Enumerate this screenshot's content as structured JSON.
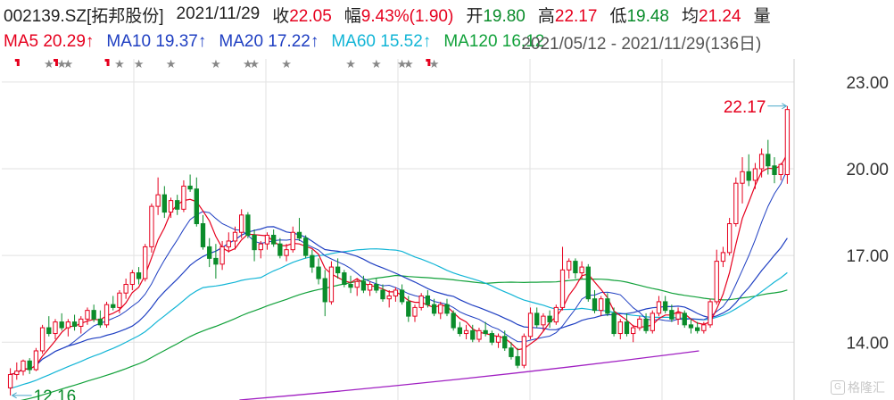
{
  "header": {
    "stock": "002139.SZ[拓邦股份]",
    "date": "2021/11/29",
    "close_label": "收",
    "close": "22.05",
    "change_label": "幅",
    "change": "9.43%(1.90)",
    "open_label": "开",
    "open": "19.80",
    "high_label": "高",
    "high": "22.17",
    "low_label": "低",
    "low": "19.48",
    "avg_label": "均",
    "avg": "21.24",
    "volume_label": "量"
  },
  "ma_legend": {
    "ma5": "MA5 20.29↑",
    "ma10": "MA10 19.37↑",
    "ma20": "MA20 17.22↑",
    "ma60": "MA60 15.52↑",
    "ma120": "MA120 16.12",
    "overlap_range": "2021/05/12 - 2021/11/29(136日)"
  },
  "colors": {
    "up": "#e6001e",
    "down": "#0a8c2b",
    "ma5": "#e6001e",
    "ma10": "#1f3fc2",
    "ma20": "#1f3fc2",
    "ma60": "#12b5d6",
    "ma120": "#11a13a",
    "ma250": "#a01fc2",
    "grid": "#e2e2e2"
  },
  "watermark": "格隆汇",
  "chart_data": {
    "type": "candlestick",
    "ylim": [
      12.0,
      23.8
    ],
    "yticks": [
      14.0,
      17.0,
      20.0,
      23.0
    ],
    "ytick_labels": [
      "14.00",
      "17.00",
      "20.00",
      "23.00"
    ],
    "annotations": {
      "max_label": "22.17",
      "min_label": "12.16"
    },
    "ohlc": [
      [
        12.42,
        13.1,
        12.16,
        12.88
      ],
      [
        12.88,
        13.3,
        12.7,
        13.0
      ],
      [
        13.0,
        13.4,
        12.85,
        13.35
      ],
      [
        13.35,
        13.45,
        12.9,
        13.05
      ],
      [
        13.05,
        13.8,
        13.0,
        13.7
      ],
      [
        13.7,
        14.6,
        13.6,
        14.5
      ],
      [
        14.5,
        14.9,
        14.2,
        14.3
      ],
      [
        14.3,
        14.8,
        14.1,
        14.7
      ],
      [
        14.7,
        15.0,
        14.4,
        14.5
      ],
      [
        14.5,
        14.8,
        14.2,
        14.7
      ],
      [
        14.7,
        14.95,
        14.4,
        14.55
      ],
      [
        14.55,
        14.9,
        14.3,
        14.8
      ],
      [
        14.8,
        15.2,
        14.6,
        15.1
      ],
      [
        15.1,
        15.3,
        14.7,
        14.8
      ],
      [
        14.8,
        15.1,
        14.5,
        14.6
      ],
      [
        14.6,
        15.4,
        14.5,
        15.3
      ],
      [
        15.3,
        15.6,
        15.1,
        15.2
      ],
      [
        15.2,
        15.8,
        15.0,
        15.7
      ],
      [
        15.7,
        16.2,
        15.5,
        16.0
      ],
      [
        16.0,
        16.5,
        15.8,
        16.4
      ],
      [
        16.4,
        16.6,
        16.0,
        16.2
      ],
      [
        16.2,
        17.4,
        16.1,
        17.3
      ],
      [
        17.3,
        18.8,
        17.1,
        18.7
      ],
      [
        18.7,
        19.7,
        18.4,
        19.1
      ],
      [
        19.1,
        19.4,
        18.3,
        18.5
      ],
      [
        18.5,
        19.0,
        18.3,
        18.9
      ],
      [
        18.9,
        19.1,
        18.4,
        18.6
      ],
      [
        18.6,
        19.6,
        18.5,
        19.4
      ],
      [
        19.4,
        19.8,
        19.2,
        19.3
      ],
      [
        19.3,
        19.7,
        18.0,
        18.1
      ],
      [
        18.1,
        18.4,
        17.2,
        17.3
      ],
      [
        17.3,
        17.6,
        16.6,
        16.9
      ],
      [
        16.9,
        17.4,
        16.2,
        16.7
      ],
      [
        16.7,
        17.5,
        16.5,
        17.3
      ],
      [
        17.3,
        17.8,
        17.1,
        17.5
      ],
      [
        17.5,
        18.0,
        17.2,
        17.8
      ],
      [
        17.8,
        18.6,
        17.6,
        18.4
      ],
      [
        18.4,
        18.5,
        17.6,
        17.7
      ],
      [
        17.7,
        17.9,
        16.8,
        17.2
      ],
      [
        17.2,
        17.5,
        16.9,
        17.4
      ],
      [
        17.4,
        17.8,
        17.2,
        17.7
      ],
      [
        17.7,
        17.9,
        17.3,
        17.4
      ],
      [
        17.4,
        17.6,
        16.9,
        17.0
      ],
      [
        17.0,
        17.4,
        16.8,
        17.2
      ],
      [
        17.2,
        18.0,
        17.1,
        17.8
      ],
      [
        17.8,
        18.3,
        17.5,
        17.6
      ],
      [
        17.6,
        17.7,
        16.9,
        17.0
      ],
      [
        17.0,
        17.2,
        16.4,
        16.6
      ],
      [
        16.6,
        16.9,
        16.0,
        16.2
      ],
      [
        16.2,
        16.5,
        14.9,
        15.4
      ],
      [
        15.4,
        16.8,
        15.3,
        16.6
      ],
      [
        16.6,
        16.9,
        16.2,
        16.4
      ],
      [
        16.4,
        16.5,
        15.9,
        16.0
      ],
      [
        16.0,
        16.3,
        15.7,
        15.9
      ],
      [
        15.9,
        16.2,
        15.6,
        16.1
      ],
      [
        16.1,
        16.3,
        15.7,
        15.8
      ],
      [
        15.8,
        16.1,
        15.6,
        16.0
      ],
      [
        16.0,
        16.2,
        15.7,
        15.8
      ],
      [
        15.8,
        16.0,
        15.4,
        15.5
      ],
      [
        15.5,
        15.8,
        15.2,
        15.6
      ],
      [
        15.6,
        15.9,
        15.4,
        15.8
      ],
      [
        15.8,
        16.0,
        15.3,
        15.4
      ],
      [
        15.4,
        15.6,
        14.7,
        14.9
      ],
      [
        14.9,
        15.3,
        14.7,
        15.2
      ],
      [
        15.2,
        15.7,
        15.1,
        15.6
      ],
      [
        15.6,
        15.8,
        15.2,
        15.3
      ],
      [
        15.3,
        15.5,
        14.9,
        15.0
      ],
      [
        15.0,
        15.4,
        14.8,
        15.3
      ],
      [
        15.3,
        15.5,
        14.9,
        15.0
      ],
      [
        15.0,
        15.1,
        14.4,
        14.5
      ],
      [
        14.5,
        14.7,
        14.2,
        14.3
      ],
      [
        14.3,
        14.6,
        14.1,
        14.4
      ],
      [
        14.4,
        14.6,
        14.0,
        14.1
      ],
      [
        14.1,
        14.5,
        14.0,
        14.4
      ],
      [
        14.4,
        14.7,
        14.2,
        14.3
      ],
      [
        14.3,
        14.4,
        13.9,
        14.0
      ],
      [
        14.0,
        14.3,
        13.8,
        14.2
      ],
      [
        14.2,
        14.4,
        13.7,
        13.8
      ],
      [
        13.8,
        14.0,
        13.4,
        13.5
      ],
      [
        13.5,
        13.8,
        13.1,
        13.2
      ],
      [
        13.2,
        14.3,
        13.1,
        14.2
      ],
      [
        14.2,
        15.2,
        14.1,
        15.0
      ],
      [
        15.0,
        15.2,
        14.5,
        14.6
      ],
      [
        14.6,
        15.0,
        14.4,
        14.9
      ],
      [
        14.9,
        15.1,
        14.5,
        14.7
      ],
      [
        14.7,
        15.3,
        14.6,
        15.2
      ],
      [
        15.2,
        17.3,
        15.1,
        16.5
      ],
      [
        16.5,
        16.9,
        16.2,
        16.8
      ],
      [
        16.8,
        16.9,
        16.2,
        16.4
      ],
      [
        16.4,
        16.8,
        16.2,
        16.6
      ],
      [
        16.6,
        16.7,
        15.4,
        15.5
      ],
      [
        15.5,
        15.8,
        15.0,
        15.1
      ],
      [
        15.1,
        15.6,
        14.9,
        15.5
      ],
      [
        15.5,
        15.7,
        14.9,
        15.0
      ],
      [
        15.0,
        15.2,
        14.2,
        14.3
      ],
      [
        14.3,
        14.8,
        14.1,
        14.7
      ],
      [
        14.7,
        15.0,
        14.2,
        14.3
      ],
      [
        14.3,
        14.6,
        14.0,
        14.5
      ],
      [
        14.5,
        14.9,
        14.4,
        14.8
      ],
      [
        14.8,
        15.0,
        14.3,
        14.4
      ],
      [
        14.4,
        15.1,
        14.3,
        15.0
      ],
      [
        15.0,
        15.6,
        14.9,
        15.4
      ],
      [
        15.4,
        15.6,
        15.0,
        15.1
      ],
      [
        15.1,
        15.3,
        14.7,
        14.8
      ],
      [
        14.8,
        15.2,
        14.6,
        15.0
      ],
      [
        15.0,
        15.1,
        14.5,
        14.6
      ],
      [
        14.6,
        14.8,
        14.3,
        14.5
      ],
      [
        14.5,
        14.7,
        14.3,
        14.4
      ],
      [
        14.4,
        14.7,
        14.3,
        14.6
      ],
      [
        14.6,
        15.5,
        14.5,
        15.4
      ],
      [
        15.4,
        17.2,
        15.3,
        16.8
      ],
      [
        16.8,
        17.3,
        16.6,
        17.1
      ],
      [
        17.1,
        18.3,
        17.0,
        18.1
      ],
      [
        18.1,
        19.7,
        18.0,
        19.5
      ],
      [
        19.5,
        20.4,
        18.8,
        19.9
      ],
      [
        19.9,
        20.5,
        19.4,
        19.6
      ],
      [
        19.6,
        20.2,
        19.3,
        20.0
      ],
      [
        20.0,
        20.7,
        19.7,
        20.5
      ],
      [
        20.5,
        21.0,
        19.8,
        20.1
      ],
      [
        20.1,
        20.4,
        19.5,
        19.8
      ],
      [
        19.8,
        20.2,
        19.6,
        20.15
      ],
      [
        19.8,
        22.17,
        19.48,
        22.05
      ]
    ],
    "moving_averages": {
      "MA250": {
        "from": [
          0.3,
          12.0
        ],
        "to": [
          0.88,
          13.7
        ]
      }
    },
    "event_markers": {
      "red_flags": [
        1,
        7,
        15,
        65
      ],
      "stars": [
        6,
        8,
        9,
        17,
        20,
        25,
        32,
        37,
        38,
        43,
        53,
        57,
        61,
        62,
        66
      ]
    }
  }
}
